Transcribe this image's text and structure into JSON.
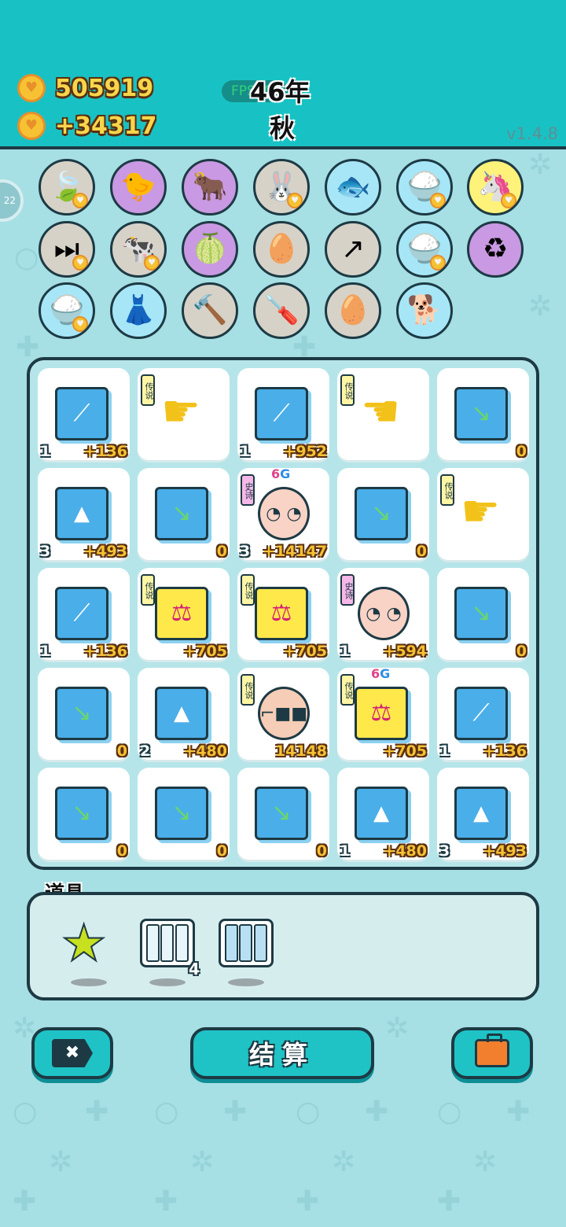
{
  "header": {
    "coins": "505919",
    "income": "+34317",
    "fps": "FPS60",
    "year": "46年",
    "season": "秋",
    "version": "v1.4.8"
  },
  "side_tab": {
    "label": "22"
  },
  "items": [
    {
      "name": "leaf-icon",
      "glyph": "🍃",
      "bg": "#d7d2c8",
      "heart": true
    },
    {
      "name": "chick-egg-icon",
      "glyph": "🐤",
      "bg": "#c999e3",
      "heart": false
    },
    {
      "name": "ox-card-icon",
      "glyph": "🐂",
      "bg": "#c999e3",
      "heart": false
    },
    {
      "name": "rabbit-icon",
      "glyph": "🐰",
      "bg": "#d7d2c8",
      "heart": true
    },
    {
      "name": "fish-tank-icon",
      "glyph": "🐟",
      "bg": "#a7e6f6",
      "heart": false
    },
    {
      "name": "rice-bowl-icon",
      "glyph": "🍚",
      "bg": "#a7e6f6",
      "heart": true
    },
    {
      "name": "unicorn-icon",
      "glyph": "🦄",
      "bg": "#fff27a",
      "heart": true
    },
    {
      "name": "skip-icon",
      "glyph": "⏭",
      "bg": "#d7d2c8",
      "heart": true
    },
    {
      "name": "cow-pair-icon",
      "glyph": "🐄",
      "bg": "#d7d2c8",
      "heart": true
    },
    {
      "name": "pomelo-icon",
      "glyph": "🍈",
      "bg": "#c999e3",
      "heart": false
    },
    {
      "name": "egg-tray-icon",
      "glyph": "🥚",
      "bg": "#d7d2c8",
      "heart": false
    },
    {
      "name": "arrow-card-icon",
      "glyph": "↗",
      "bg": "#d7d2c8",
      "heart": false
    },
    {
      "name": "rice-bowl-icon",
      "glyph": "🍚",
      "bg": "#a7e6f6",
      "heart": true
    },
    {
      "name": "recycle-icon",
      "glyph": "♻",
      "bg": "#c999e3",
      "heart": false
    },
    {
      "name": "rice-bowl-icon",
      "glyph": "🍚",
      "bg": "#a7e6f6",
      "heart": true
    },
    {
      "name": "skirt-icon",
      "glyph": "👗",
      "bg": "#a7e6f6",
      "heart": false
    },
    {
      "name": "hammer-icon",
      "glyph": "🔨",
      "bg": "#d7d2c8",
      "heart": false
    },
    {
      "name": "screwdriver-icon",
      "glyph": "🪛",
      "bg": "#d7d2c8",
      "heart": false
    },
    {
      "name": "egg-tray-icon",
      "glyph": "🥚",
      "bg": "#d7d2c8",
      "heart": false
    },
    {
      "name": "shiba-dog-icon",
      "glyph": "🐕",
      "bg": "#a7e6f6",
      "heart": false
    }
  ],
  "board": [
    {
      "type": "up",
      "level": "1",
      "value": "+136",
      "tag": "",
      "sixg": false
    },
    {
      "type": "hand-down",
      "level": "",
      "value": "",
      "tag": "传说",
      "sixg": false
    },
    {
      "type": "up",
      "level": "1",
      "value": "+952",
      "tag": "",
      "sixg": false
    },
    {
      "type": "hand-left",
      "level": "",
      "value": "",
      "tag": "传说",
      "sixg": false
    },
    {
      "type": "down",
      "level": "",
      "value": "0",
      "tag": "",
      "sixg": false
    },
    {
      "type": "gold",
      "level": "3",
      "value": "+493",
      "tag": "",
      "sixg": false
    },
    {
      "type": "down",
      "level": "",
      "value": "0",
      "tag": "",
      "sixg": false
    },
    {
      "type": "old-man",
      "level": "3",
      "value": "+14147",
      "tag": "史诗",
      "sixg": true
    },
    {
      "type": "down",
      "level": "",
      "value": "0",
      "tag": "",
      "sixg": false
    },
    {
      "type": "hand-down",
      "level": "",
      "value": "",
      "tag": "传说",
      "sixg": false
    },
    {
      "type": "up",
      "level": "1",
      "value": "+136",
      "tag": "",
      "sixg": false
    },
    {
      "type": "scale",
      "level": "",
      "value": "+705",
      "tag": "传说",
      "sixg": false
    },
    {
      "type": "scale",
      "level": "",
      "value": "+705",
      "tag": "传说",
      "sixg": false
    },
    {
      "type": "old-man",
      "level": "1",
      "value": "+594",
      "tag": "史诗",
      "sixg": false
    },
    {
      "type": "down",
      "level": "",
      "value": "0",
      "tag": "",
      "sixg": false
    },
    {
      "type": "down",
      "level": "",
      "value": "0",
      "tag": "",
      "sixg": false
    },
    {
      "type": "gold",
      "level": "2",
      "value": "+480",
      "tag": "",
      "sixg": false
    },
    {
      "type": "rich-man",
      "level": "",
      "value": "14148",
      "tag": "传说",
      "sixg": false
    },
    {
      "type": "scale",
      "level": "",
      "value": "+705",
      "tag": "传说",
      "sixg": true
    },
    {
      "type": "up",
      "level": "1",
      "value": "+136",
      "tag": "",
      "sixg": false
    },
    {
      "type": "down",
      "level": "",
      "value": "0",
      "tag": "",
      "sixg": false
    },
    {
      "type": "down",
      "level": "",
      "value": "0",
      "tag": "",
      "sixg": false
    },
    {
      "type": "down",
      "level": "",
      "value": "0",
      "tag": "",
      "sixg": false
    },
    {
      "type": "gold",
      "level": "1",
      "value": "+480",
      "tag": "",
      "sixg": false
    },
    {
      "type": "gold",
      "level": "3",
      "value": "+493",
      "tag": "",
      "sixg": false
    }
  ],
  "sixg_label": {
    "six": "6",
    "g": "G"
  },
  "props": {
    "title": "道具",
    "items": [
      {
        "name": "star-prop",
        "count": ""
      },
      {
        "name": "empty-slots-prop",
        "count": "4"
      },
      {
        "name": "filled-slots-prop",
        "count": ""
      }
    ]
  },
  "buttons": {
    "close_glyph": "✖",
    "settle": "结算"
  },
  "icons": {
    "coin": "♥",
    "up": "⟋",
    "down": "↘",
    "gold": "▲",
    "scale": "⚖",
    "hand-down": "☛",
    "hand-left": "☚",
    "heart": "♥",
    "star": "★"
  }
}
